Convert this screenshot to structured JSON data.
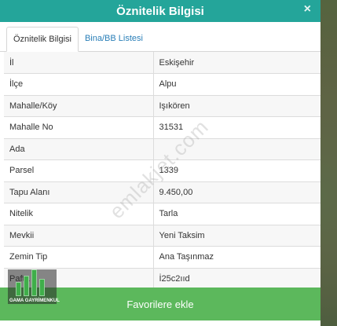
{
  "modal": {
    "title": "Öznitelik Bilgisi",
    "close_label": "×"
  },
  "tabs": [
    {
      "label": "Öznitelik Bilgisi",
      "active": true
    },
    {
      "label": "Bina/BB Listesi",
      "active": false
    }
  ],
  "attributes": [
    {
      "key": "İl",
      "value": "Eskişehir"
    },
    {
      "key": "İlçe",
      "value": "Alpu"
    },
    {
      "key": "Mahalle/Köy",
      "value": "Işıkören"
    },
    {
      "key": "Mahalle No",
      "value": "31531"
    },
    {
      "key": "Ada",
      "value": ""
    },
    {
      "key": "Parsel",
      "value": "1339"
    },
    {
      "key": "Tapu Alanı",
      "value": "9.450,00"
    },
    {
      "key": "Nitelik",
      "value": "Tarla"
    },
    {
      "key": "Mevkii",
      "value": "Yeni Taksim"
    },
    {
      "key": "Zemin Tip",
      "value": "Ana Taşınmaz"
    },
    {
      "key": "Pafta",
      "value": "İ25c2ııd"
    }
  ],
  "watermark": "emlakjet.com",
  "favorite_button_label": "Favorilere ekle",
  "logo_text": "GAMA GAYRİMENKUL",
  "colors": {
    "header": "#24a59a",
    "tab_link": "#2a7fb8",
    "favorite_button": "#5cb85c"
  }
}
